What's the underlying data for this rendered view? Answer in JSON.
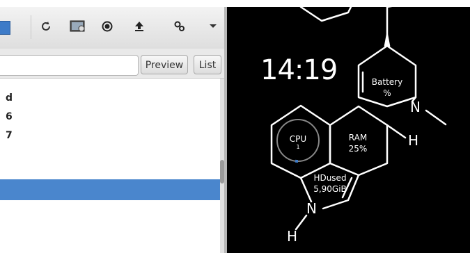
{
  "toolbar": {
    "icons": [
      "reload-icon",
      "screen-settings-icon",
      "record-icon",
      "upload-icon",
      "gears-icon",
      "dropdown-arrow-icon"
    ]
  },
  "searchbar": {
    "address_value": "",
    "preview_label": "Preview",
    "list_label": "List"
  },
  "file_list": {
    "rows": [
      "d",
      "6",
      "7"
    ]
  },
  "widget": {
    "clock": "14:19",
    "battery_label": "Battery",
    "battery_value": "%",
    "cpu_label": "CPU",
    "cpu_value": "1",
    "ram_label": "RAM",
    "ram_value": "25%",
    "hd_label": "HDused",
    "hd_value": "5,90GiB",
    "atoms": {
      "n1": "N",
      "h1": "H",
      "n2": "N",
      "h2": "H"
    }
  },
  "colors": {
    "selection": "#4a86cd",
    "accent": "#3d7bc8",
    "widget_bg": "#000000",
    "widget_fg": "#ffffff"
  }
}
